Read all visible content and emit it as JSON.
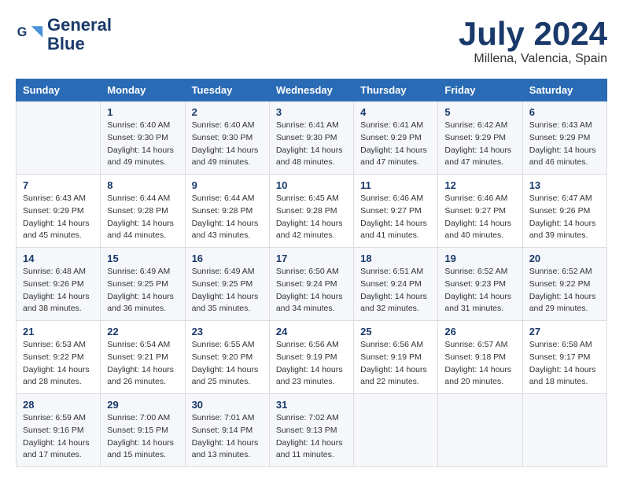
{
  "header": {
    "logo_line1": "General",
    "logo_line2": "Blue",
    "month_title": "July 2024",
    "location": "Millena, Valencia, Spain"
  },
  "weekdays": [
    "Sunday",
    "Monday",
    "Tuesday",
    "Wednesday",
    "Thursday",
    "Friday",
    "Saturday"
  ],
  "weeks": [
    [
      {
        "day": "",
        "sunrise": "",
        "sunset": "",
        "daylight": ""
      },
      {
        "day": "1",
        "sunrise": "Sunrise: 6:40 AM",
        "sunset": "Sunset: 9:30 PM",
        "daylight": "Daylight: 14 hours and 49 minutes."
      },
      {
        "day": "2",
        "sunrise": "Sunrise: 6:40 AM",
        "sunset": "Sunset: 9:30 PM",
        "daylight": "Daylight: 14 hours and 49 minutes."
      },
      {
        "day": "3",
        "sunrise": "Sunrise: 6:41 AM",
        "sunset": "Sunset: 9:30 PM",
        "daylight": "Daylight: 14 hours and 48 minutes."
      },
      {
        "day": "4",
        "sunrise": "Sunrise: 6:41 AM",
        "sunset": "Sunset: 9:29 PM",
        "daylight": "Daylight: 14 hours and 47 minutes."
      },
      {
        "day": "5",
        "sunrise": "Sunrise: 6:42 AM",
        "sunset": "Sunset: 9:29 PM",
        "daylight": "Daylight: 14 hours and 47 minutes."
      },
      {
        "day": "6",
        "sunrise": "Sunrise: 6:43 AM",
        "sunset": "Sunset: 9:29 PM",
        "daylight": "Daylight: 14 hours and 46 minutes."
      }
    ],
    [
      {
        "day": "7",
        "sunrise": "Sunrise: 6:43 AM",
        "sunset": "Sunset: 9:29 PM",
        "daylight": "Daylight: 14 hours and 45 minutes."
      },
      {
        "day": "8",
        "sunrise": "Sunrise: 6:44 AM",
        "sunset": "Sunset: 9:28 PM",
        "daylight": "Daylight: 14 hours and 44 minutes."
      },
      {
        "day": "9",
        "sunrise": "Sunrise: 6:44 AM",
        "sunset": "Sunset: 9:28 PM",
        "daylight": "Daylight: 14 hours and 43 minutes."
      },
      {
        "day": "10",
        "sunrise": "Sunrise: 6:45 AM",
        "sunset": "Sunset: 9:28 PM",
        "daylight": "Daylight: 14 hours and 42 minutes."
      },
      {
        "day": "11",
        "sunrise": "Sunrise: 6:46 AM",
        "sunset": "Sunset: 9:27 PM",
        "daylight": "Daylight: 14 hours and 41 minutes."
      },
      {
        "day": "12",
        "sunrise": "Sunrise: 6:46 AM",
        "sunset": "Sunset: 9:27 PM",
        "daylight": "Daylight: 14 hours and 40 minutes."
      },
      {
        "day": "13",
        "sunrise": "Sunrise: 6:47 AM",
        "sunset": "Sunset: 9:26 PM",
        "daylight": "Daylight: 14 hours and 39 minutes."
      }
    ],
    [
      {
        "day": "14",
        "sunrise": "Sunrise: 6:48 AM",
        "sunset": "Sunset: 9:26 PM",
        "daylight": "Daylight: 14 hours and 38 minutes."
      },
      {
        "day": "15",
        "sunrise": "Sunrise: 6:49 AM",
        "sunset": "Sunset: 9:25 PM",
        "daylight": "Daylight: 14 hours and 36 minutes."
      },
      {
        "day": "16",
        "sunrise": "Sunrise: 6:49 AM",
        "sunset": "Sunset: 9:25 PM",
        "daylight": "Daylight: 14 hours and 35 minutes."
      },
      {
        "day": "17",
        "sunrise": "Sunrise: 6:50 AM",
        "sunset": "Sunset: 9:24 PM",
        "daylight": "Daylight: 14 hours and 34 minutes."
      },
      {
        "day": "18",
        "sunrise": "Sunrise: 6:51 AM",
        "sunset": "Sunset: 9:24 PM",
        "daylight": "Daylight: 14 hours and 32 minutes."
      },
      {
        "day": "19",
        "sunrise": "Sunrise: 6:52 AM",
        "sunset": "Sunset: 9:23 PM",
        "daylight": "Daylight: 14 hours and 31 minutes."
      },
      {
        "day": "20",
        "sunrise": "Sunrise: 6:52 AM",
        "sunset": "Sunset: 9:22 PM",
        "daylight": "Daylight: 14 hours and 29 minutes."
      }
    ],
    [
      {
        "day": "21",
        "sunrise": "Sunrise: 6:53 AM",
        "sunset": "Sunset: 9:22 PM",
        "daylight": "Daylight: 14 hours and 28 minutes."
      },
      {
        "day": "22",
        "sunrise": "Sunrise: 6:54 AM",
        "sunset": "Sunset: 9:21 PM",
        "daylight": "Daylight: 14 hours and 26 minutes."
      },
      {
        "day": "23",
        "sunrise": "Sunrise: 6:55 AM",
        "sunset": "Sunset: 9:20 PM",
        "daylight": "Daylight: 14 hours and 25 minutes."
      },
      {
        "day": "24",
        "sunrise": "Sunrise: 6:56 AM",
        "sunset": "Sunset: 9:19 PM",
        "daylight": "Daylight: 14 hours and 23 minutes."
      },
      {
        "day": "25",
        "sunrise": "Sunrise: 6:56 AM",
        "sunset": "Sunset: 9:19 PM",
        "daylight": "Daylight: 14 hours and 22 minutes."
      },
      {
        "day": "26",
        "sunrise": "Sunrise: 6:57 AM",
        "sunset": "Sunset: 9:18 PM",
        "daylight": "Daylight: 14 hours and 20 minutes."
      },
      {
        "day": "27",
        "sunrise": "Sunrise: 6:58 AM",
        "sunset": "Sunset: 9:17 PM",
        "daylight": "Daylight: 14 hours and 18 minutes."
      }
    ],
    [
      {
        "day": "28",
        "sunrise": "Sunrise: 6:59 AM",
        "sunset": "Sunset: 9:16 PM",
        "daylight": "Daylight: 14 hours and 17 minutes."
      },
      {
        "day": "29",
        "sunrise": "Sunrise: 7:00 AM",
        "sunset": "Sunset: 9:15 PM",
        "daylight": "Daylight: 14 hours and 15 minutes."
      },
      {
        "day": "30",
        "sunrise": "Sunrise: 7:01 AM",
        "sunset": "Sunset: 9:14 PM",
        "daylight": "Daylight: 14 hours and 13 minutes."
      },
      {
        "day": "31",
        "sunrise": "Sunrise: 7:02 AM",
        "sunset": "Sunset: 9:13 PM",
        "daylight": "Daylight: 14 hours and 11 minutes."
      },
      {
        "day": "",
        "sunrise": "",
        "sunset": "",
        "daylight": ""
      },
      {
        "day": "",
        "sunrise": "",
        "sunset": "",
        "daylight": ""
      },
      {
        "day": "",
        "sunrise": "",
        "sunset": "",
        "daylight": ""
      }
    ]
  ]
}
